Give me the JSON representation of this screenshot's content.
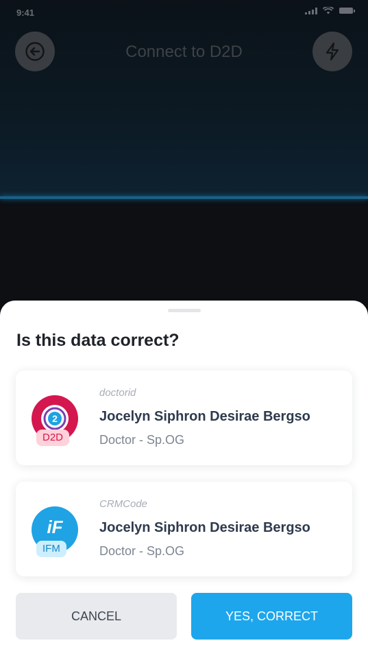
{
  "status_bar": {
    "time": "9:41"
  },
  "header": {
    "title": "Connect to D2D",
    "back_icon": "arrow-left-icon",
    "flash_icon": "lightning-icon"
  },
  "sheet": {
    "title": "Is this data correct?",
    "cards": [
      {
        "logo_badge": "D2D",
        "label": "doctorid",
        "name": "Jocelyn Siphron Desirae Bergso",
        "role": "Doctor - Sp.OG",
        "brand_color": "#d4174e"
      },
      {
        "logo_text": "iF",
        "logo_badge": "IFM",
        "label": "CRMCode",
        "name": "Jocelyn Siphron Desirae Bergso",
        "role": "Doctor - Sp.OG",
        "brand_color": "#1fa3e4"
      }
    ],
    "buttons": {
      "cancel": "CANCEL",
      "confirm": "YES, CORRECT"
    }
  },
  "colors": {
    "accent": "#1ea6ec",
    "scan_line": "#1b5f86"
  }
}
